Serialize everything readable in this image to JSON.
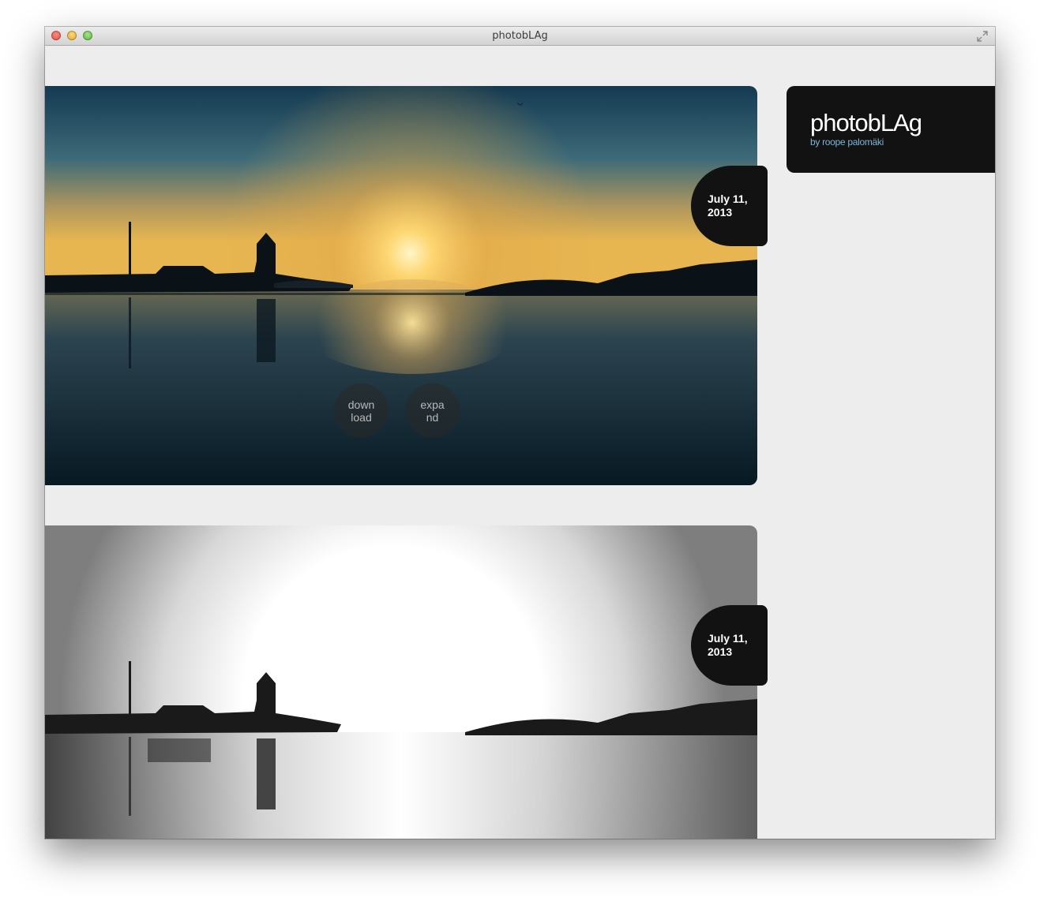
{
  "window": {
    "title": "photobLAg"
  },
  "header": {
    "brand_title": "photobLAg",
    "brand_subtitle": "by roope palomäki"
  },
  "posts": [
    {
      "date": "July 11,\n2013",
      "download_label": "down\nload",
      "expand_label": "expa\nnd"
    },
    {
      "date": "July 11,\n2013"
    }
  ],
  "colors": {
    "page_background": "#ededed",
    "badge_background": "#121212",
    "subtitle_accent": "#7fb3d8"
  }
}
